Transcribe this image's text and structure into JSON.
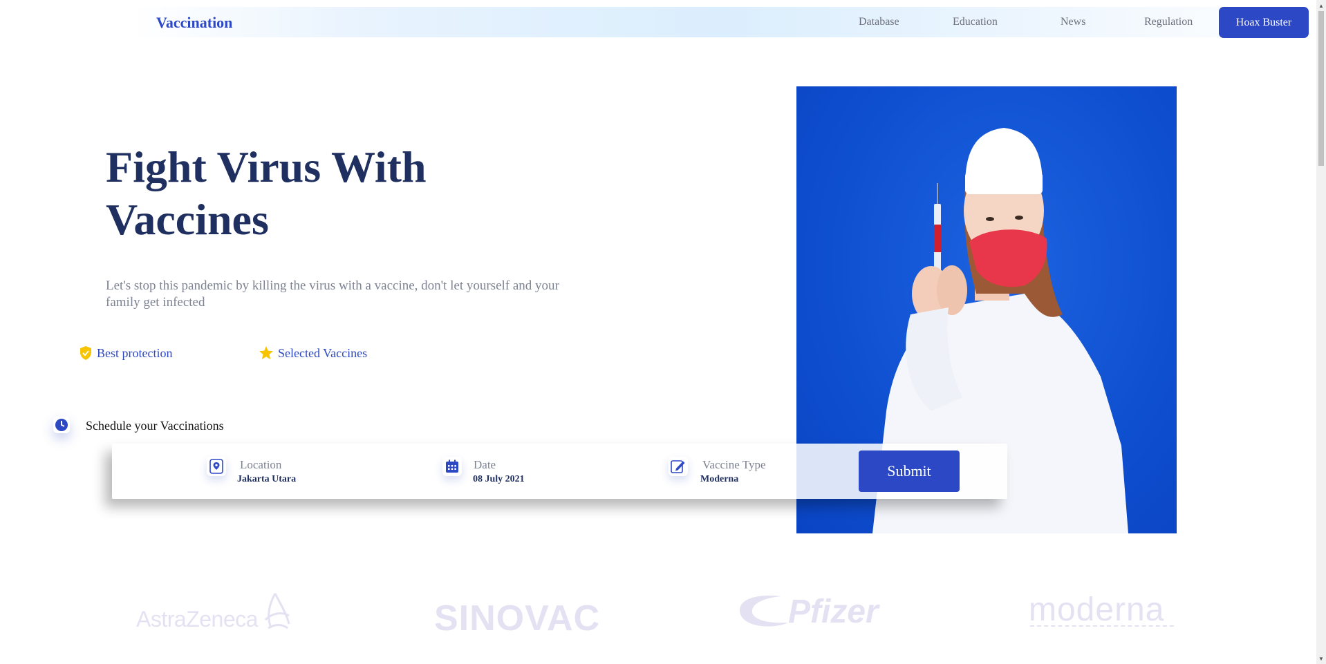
{
  "header": {
    "brand": "Vaccination",
    "nav": [
      "Database",
      "Education",
      "News",
      "Regulation"
    ],
    "cta": "Hoax Buster"
  },
  "hero": {
    "title_line1": "Fight Virus With",
    "title_line2": "Vaccines",
    "subtitle": "Let's stop this pandemic by killing the virus with a vaccine, don't let yourself and your family get infected",
    "features": [
      "Best protection",
      "Selected Vaccines"
    ]
  },
  "schedule": {
    "label": "Schedule your Vaccinations",
    "fields": [
      {
        "label": "Location",
        "value": "Jakarta Utara",
        "icon": "map-pin-icon"
      },
      {
        "label": "Date",
        "value": "08 July 2021",
        "icon": "calendar-icon"
      },
      {
        "label": "Vaccine Type",
        "value": "Moderna",
        "icon": "edit-icon"
      }
    ],
    "submit": "Submit"
  },
  "partners": [
    "AstraZeneca",
    "SINOVAC",
    "Pfizer",
    "moderna"
  ],
  "colors": {
    "primary": "#2c48c4",
    "heading": "#1f2f5f",
    "accent_yellow": "#f6c400",
    "image_bg": "#0e4fd0"
  }
}
